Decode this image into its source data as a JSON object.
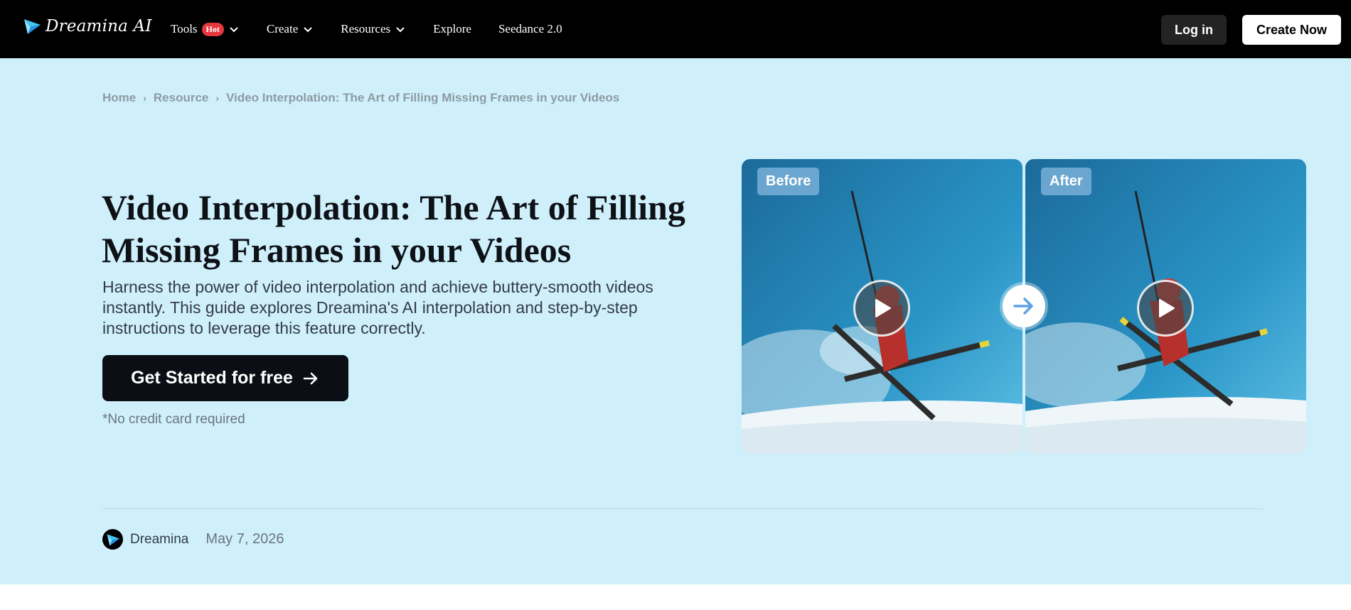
{
  "nav": {
    "logo_text": "Dreamina AI",
    "links": [
      {
        "label": "Tools",
        "badge": "Hot",
        "dropdown": true
      },
      {
        "label": "Create",
        "dropdown": true
      },
      {
        "label": "Resources",
        "dropdown": true
      },
      {
        "label": "Explore",
        "dropdown": false
      },
      {
        "label": "Seedance 2.0",
        "dropdown": false
      }
    ],
    "login_label": "Log in",
    "create_label": "Create Now"
  },
  "breadcrumb": [
    "Home",
    "Resource",
    "Video Interpolation: The Art of Filling Missing Frames in your Videos"
  ],
  "hero": {
    "title": "Video Interpolation: The Art of Filling Missing Frames in your Videos",
    "subtitle": "Harness the power of video interpolation and achieve buttery-smooth videos instantly. This guide explores Dreamina's AI interpolation and step-by-step instructions to leverage this feature correctly.",
    "cta_label": "Get Started for free",
    "note": "*No credit card required",
    "before_label": "Before",
    "after_label": "After"
  },
  "meta": {
    "author": "Dreamina",
    "date": "May 7, 2026"
  },
  "colors": {
    "nav_bg": "#000000",
    "hero_bg": "#cff0fb",
    "hot_badge": "#e5373e",
    "cta_bg": "#0b0e14"
  }
}
